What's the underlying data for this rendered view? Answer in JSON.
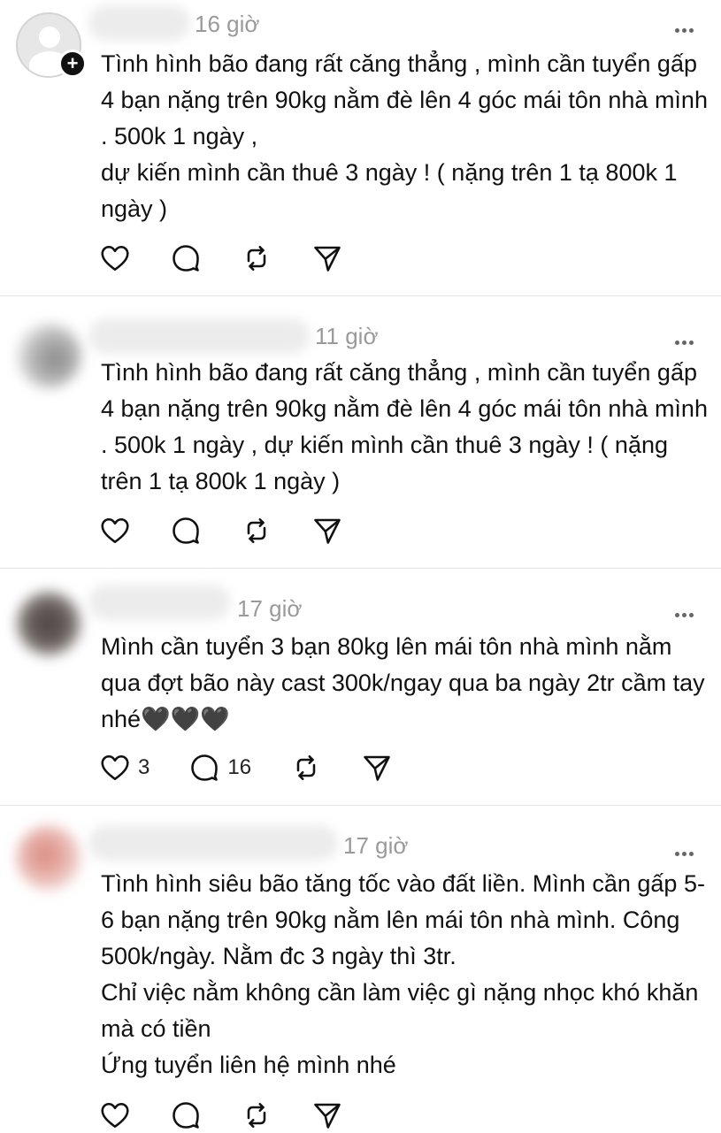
{
  "posts": [
    {
      "time": "16 giờ",
      "text": "Tình hình bão đang rất căng thẳng , mình cần tuyển gấp 4 bạn nặng trên 90kg nằm đè lên 4 góc mái tôn nhà mình . 500k 1 ngày ,\ndự kiến mình cần thuê 3 ngày ! ( nặng trên 1 tạ 800k 1 ngày )",
      "likes": "",
      "comments": ""
    },
    {
      "time": "11 giờ",
      "text": "Tình hình bão đang rất căng thẳng , mình cần tuyển gấp 4 bạn nặng trên 90kg nằm đè lên 4 góc mái tôn nhà mình . 500k 1 ngày , dự kiến mình cần thuê 3 ngày ! ( nặng trên 1 tạ 800k 1 ngày )",
      "likes": "",
      "comments": ""
    },
    {
      "time": "17 giờ",
      "text": "Mình cần tuyển 3 bạn 80kg lên mái tôn nhà mình nằm qua đợt bão này cast 300k/ngay qua ba ngày 2tr cầm tay nhé🖤🖤🖤",
      "likes": "3",
      "comments": "16"
    },
    {
      "time": "17 giờ",
      "text": "Tình hình siêu bão tăng tốc vào đất liền. Mình cần gấp 5-6 bạn nặng trên 90kg nằm lên mái tôn nhà mình. Công 500k/ngày. Nằm đc 3 ngày thì 3tr.\nChỉ việc nằm không cần làm việc gì nặng nhọc khó khăn mà có tiền\nỨng tuyển liên hệ mình nhé",
      "likes": "",
      "comments": ""
    }
  ],
  "icons": {
    "like": "heart-icon",
    "comment": "comment-icon",
    "repost": "repost-icon",
    "share": "send-icon",
    "more": "more-icon",
    "follow": "plus-icon"
  }
}
